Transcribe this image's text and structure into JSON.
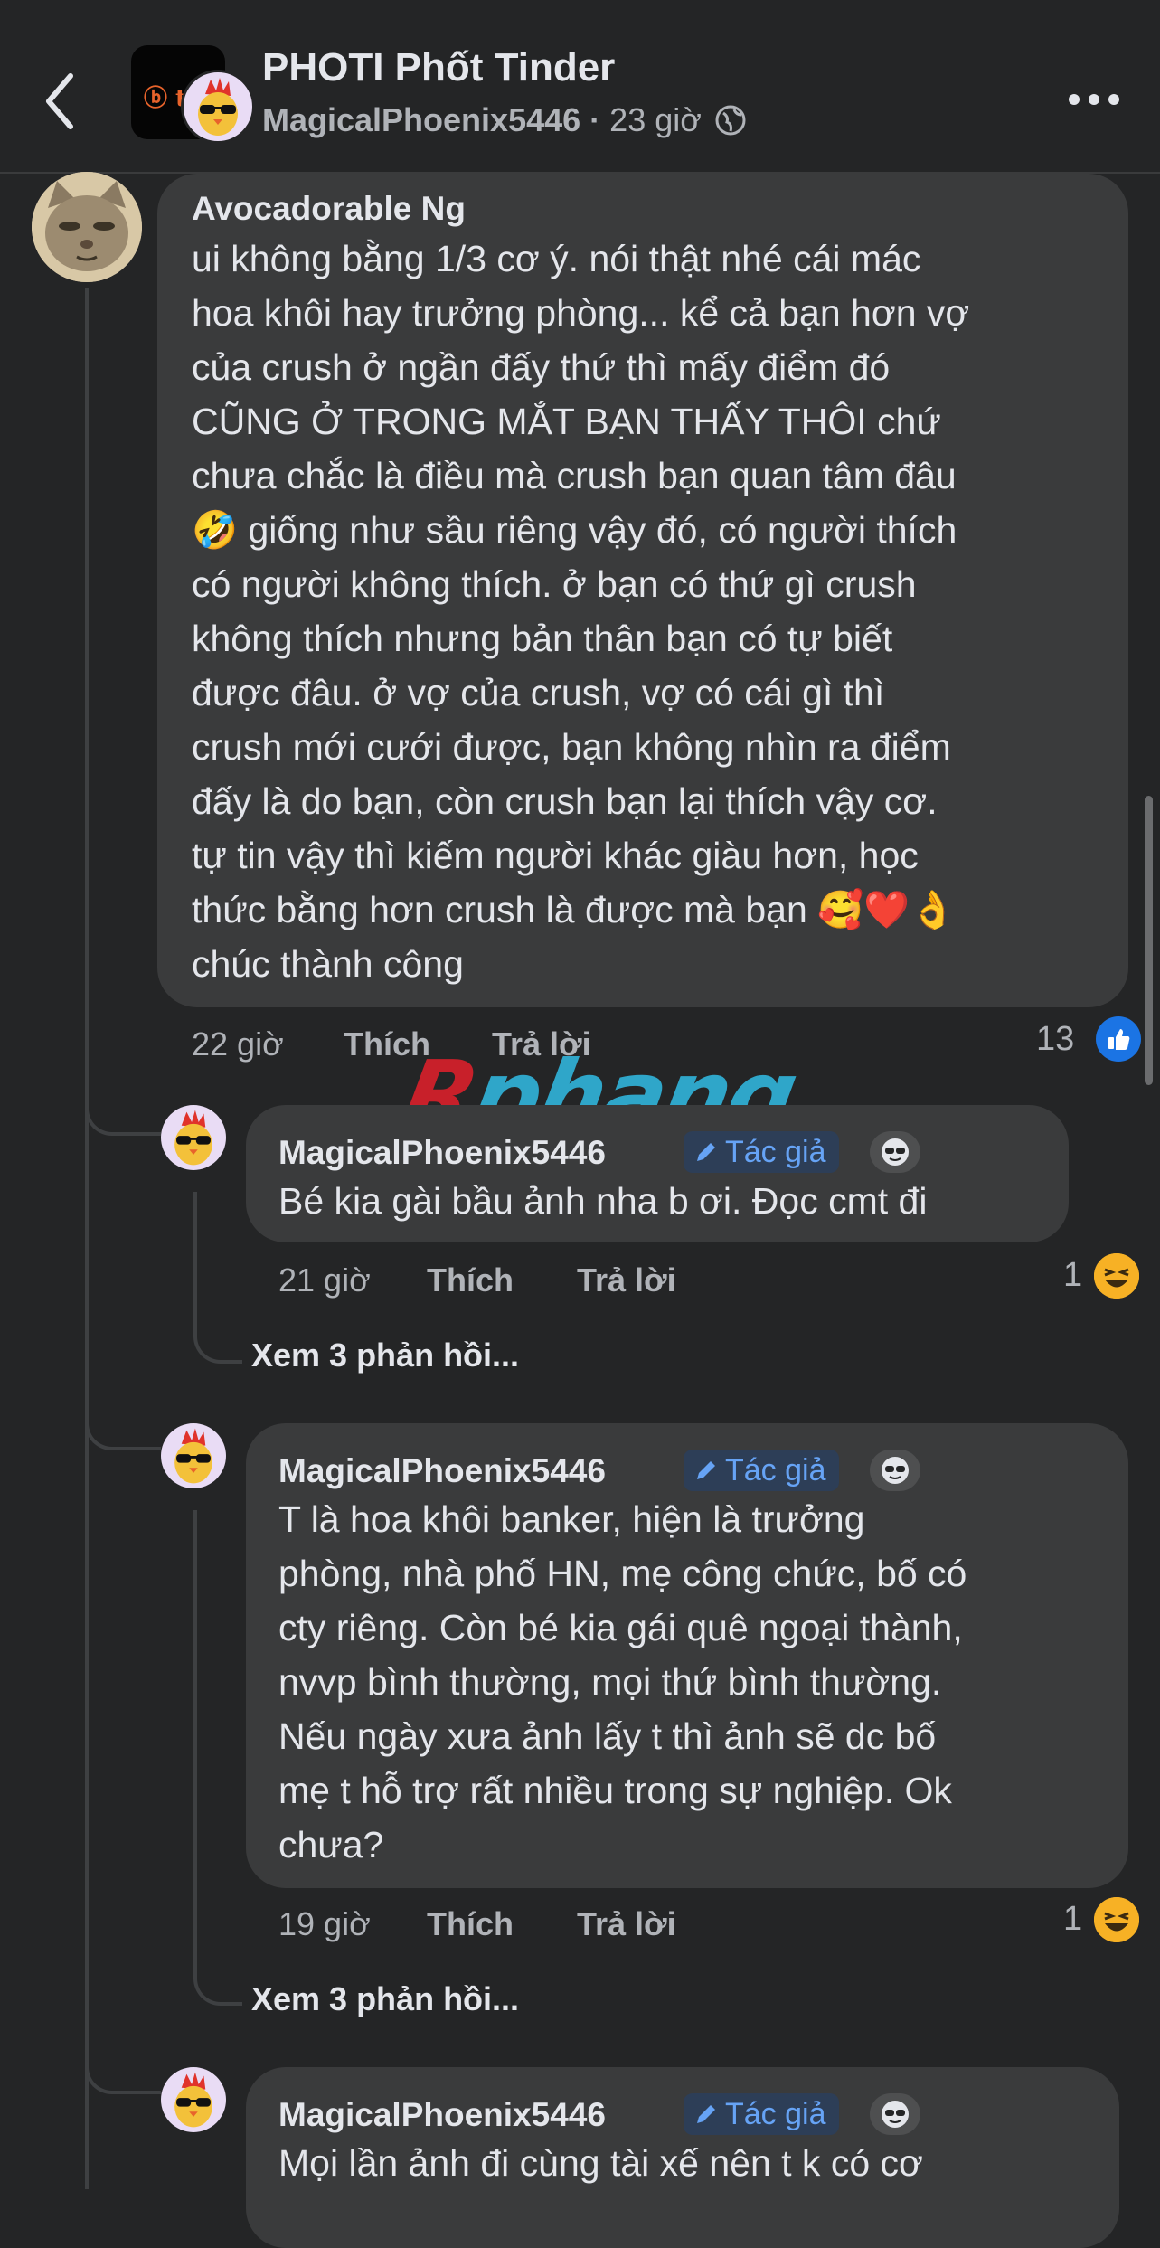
{
  "header": {
    "group_name": "PHOTI Phốt Tinder",
    "poster_name": "MagicalPhoenix5446",
    "separator": "·",
    "post_time": "23 giờ",
    "group_avatar_glyph": "ⓑ tin"
  },
  "comments": [
    {
      "author": "Avocadorable Ng",
      "text": "ui không bằng 1/3 cơ ý. nói thật nhé cái mác\nhoa khôi hay trưởng phòng... kể cả bạn hơn vợ\ncủa crush ở ngần đấy thứ thì mấy điểm đó\nCŨNG Ở TRONG MẮT BẠN THẤY THÔI chứ\nchưa chắc là điều mà crush bạn quan tâm đâu\n🤣 giống như sầu riêng vậy đó, có người thích\ncó người không thích. ở bạn có thứ gì crush\nkhông thích nhưng bản thân bạn có tự biết\nđược đâu. ở vợ của crush, vợ có cái gì thì\ncrush mới cưới được, bạn không nhìn ra điểm\nđấy là do bạn, còn crush bạn lại thích vậy cơ.\ntự tin vậy thì kiếm người khác giàu hơn, học\nthức bằng hơn crush là được mà bạn 🥰❤️👌\nchúc thành công",
      "time": "22 giờ",
      "like": "Thích",
      "reply": "Trả lời",
      "reaction_count": "13",
      "reaction_icon": "like-icon"
    },
    {
      "author": "MagicalPhoenix5446",
      "badge": "Tác giả",
      "text": "Bé kia gài bầu ảnh nha b ơi. Đọc cmt đi",
      "time": "21 giờ",
      "like": "Thích",
      "reply": "Trả lời",
      "reaction_count": "1",
      "reaction_icon": "haha-icon",
      "view_replies": "Xem 3 phản hồi..."
    },
    {
      "author": "MagicalPhoenix5446",
      "badge": "Tác giả",
      "text": "T là hoa khôi banker, hiện là trưởng\nphòng, nhà phố HN, mẹ công chức, bố có\ncty riêng. Còn bé kia gái quê ngoại thành,\nnvvp bình thường, mọi thứ bình thường.\nNếu ngày xưa ảnh lấy t thì ảnh sẽ dc bố\nmẹ t hỗ trợ rất nhiều trong sự nghiệp. Ok\nchưa?",
      "time": "19 giờ",
      "like": "Thích",
      "reply": "Trả lời",
      "reaction_count": "1",
      "reaction_icon": "haha-icon",
      "view_replies": "Xem 3 phản hồi..."
    },
    {
      "author": "MagicalPhoenix5446",
      "badge": "Tác giả",
      "text": "Mọi lần ảnh đi cùng tài xế nên t k có cơ"
    }
  ],
  "watermark": {
    "part1": "R",
    "part2": "phang"
  },
  "colors": {
    "background": "#242526",
    "bubble": "#3a3b3c",
    "text": "#e4e6eb",
    "secondary_text": "#b0b3b8",
    "badge_text": "#66a3f5",
    "like_blue": "#1b74e4",
    "haha_yellow": "#f7b125"
  },
  "icons": {
    "back": "chevron-left-icon",
    "more": "more-horizontal-icon",
    "privacy": "globe-icon",
    "badge": "pencil-icon",
    "mod": "sunglasses-icon"
  }
}
